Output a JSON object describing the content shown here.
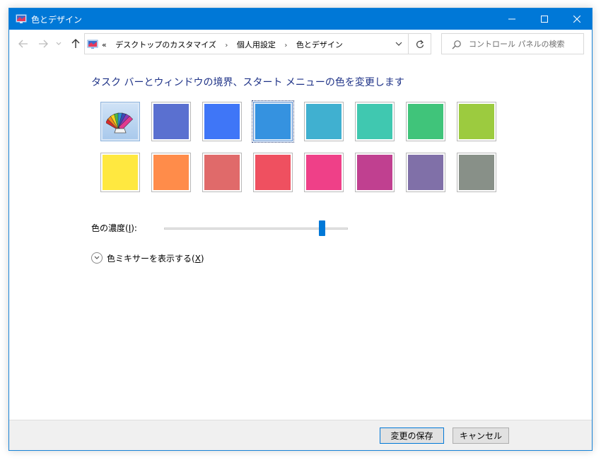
{
  "window": {
    "title": "色とデザイン",
    "accent": "#0078d7"
  },
  "nav": {
    "address": {
      "overflow": "«",
      "crumbs": [
        "デスクトップのカスタマイズ",
        "個人用設定",
        "色とデザイン"
      ],
      "separator": "›"
    },
    "search": {
      "placeholder": "コントロール パネルの検索"
    }
  },
  "main": {
    "heading": "タスク バーとウィンドウの境界、スタート メニューの色を変更します",
    "swatches": [
      {
        "name": "automatic",
        "color": "auto"
      },
      {
        "name": "slate-blue",
        "color": "#5a70d0"
      },
      {
        "name": "blue",
        "color": "#3f76f7"
      },
      {
        "name": "sky-blue",
        "color": "#3592e0",
        "selected": true
      },
      {
        "name": "teal-blue",
        "color": "#40b0d0"
      },
      {
        "name": "aqua",
        "color": "#40c8b0"
      },
      {
        "name": "green",
        "color": "#40c47a"
      },
      {
        "name": "lime",
        "color": "#9ccb3f"
      },
      {
        "name": "yellow",
        "color": "#ffe840"
      },
      {
        "name": "orange",
        "color": "#ff8c4a"
      },
      {
        "name": "coral",
        "color": "#e06a6a"
      },
      {
        "name": "red",
        "color": "#ef5060"
      },
      {
        "name": "pink",
        "color": "#ef4088"
      },
      {
        "name": "magenta",
        "color": "#c04090"
      },
      {
        "name": "purple",
        "color": "#8070a8"
      },
      {
        "name": "gray-green",
        "color": "#889088"
      }
    ],
    "intensity": {
      "label_prefix": "色の濃度(",
      "label_key": "I",
      "label_suffix": "):",
      "value": 0.86
    },
    "mixer": {
      "label_prefix": "色ミキサーを表示する(",
      "label_key": "X",
      "label_suffix": ")"
    }
  },
  "footer": {
    "save_label": "変更の保存",
    "cancel_label": "キャンセル"
  }
}
